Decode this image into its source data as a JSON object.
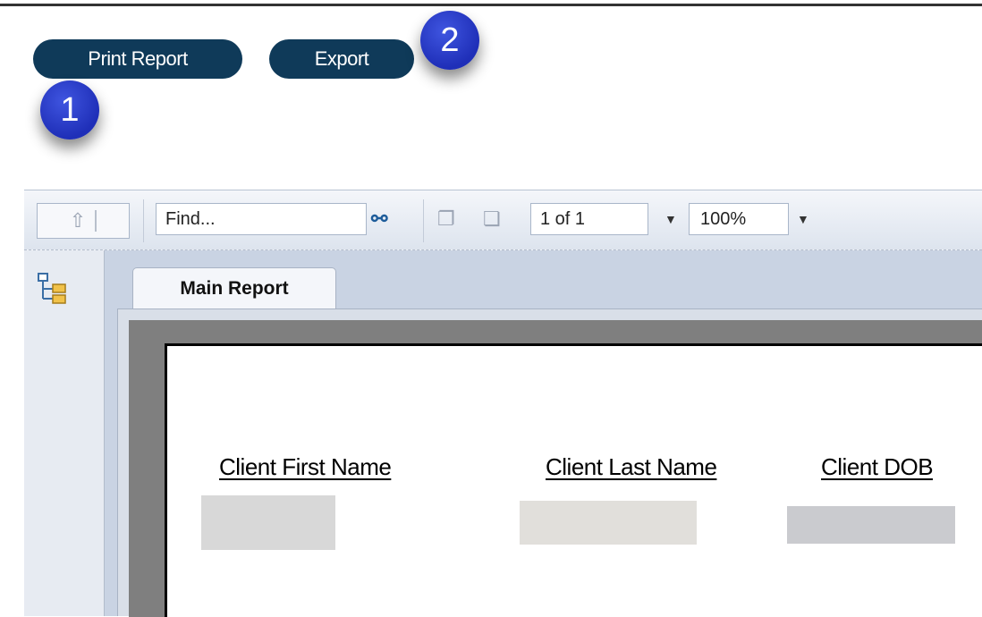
{
  "actions": {
    "print_label": "Print Report",
    "export_label": "Export"
  },
  "step_badges": [
    "1",
    "2"
  ],
  "toolbar": {
    "up_icon": "up-arrow-icon",
    "find_placeholder": "Find...",
    "search_icon": "binoculars-icon",
    "page_value": "1 of 1",
    "zoom_value": "100%"
  },
  "report": {
    "tab_label": "Main Report",
    "columns": [
      "Client First Name",
      "Client Last Name",
      "Client DOB"
    ]
  },
  "colors": {
    "button_bg": "#0f3a59",
    "badge_bg": "#1f2fb8",
    "viewer_bg": "#c9d3e3"
  }
}
